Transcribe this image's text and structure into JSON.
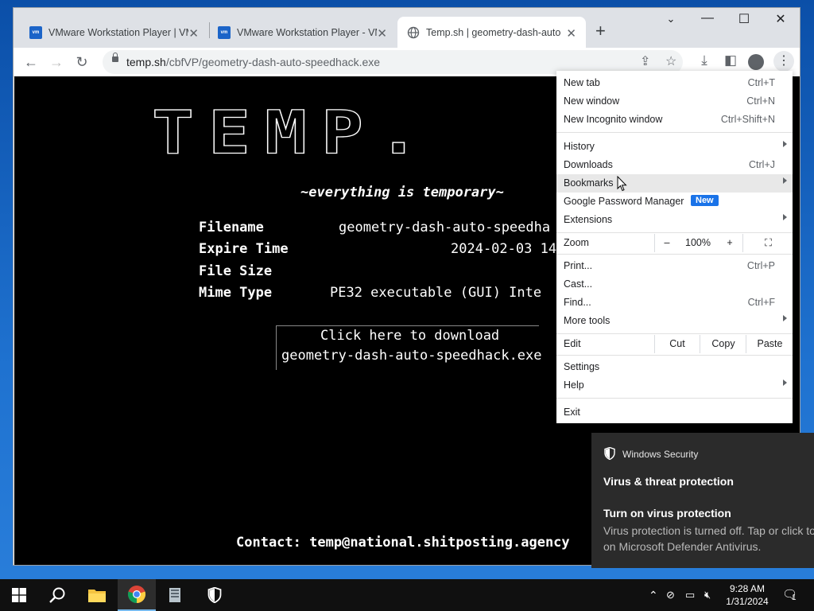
{
  "browser": {
    "tabs": [
      {
        "title": "VMware Workstation Player | VM",
        "favicon": "vmware",
        "active": false
      },
      {
        "title": "VMware Workstation Player - VM",
        "favicon": "vmware",
        "active": false
      },
      {
        "title": "Temp.sh | geometry-dash-auto-s",
        "favicon": "globe",
        "active": true
      }
    ],
    "url_host": "temp.sh",
    "url_path": "/cbfVP/geometry-dash-auto-speedhack.exe"
  },
  "page": {
    "logo": "TEMP.",
    "tagline": "~everything is temporary~",
    "info": [
      {
        "label": "Filename",
        "value": "geometry-dash-auto-speedha"
      },
      {
        "label": "Expire Time",
        "value": "2024-02-03 14"
      },
      {
        "label": "File Size",
        "value": ""
      },
      {
        "label": "Mime Type",
        "value": "PE32 executable (GUI) Inte"
      }
    ],
    "download_line1": "Click here to download",
    "download_line2": "geometry-dash-auto-speedhack.exe",
    "contact_label": "Contact:",
    "contact_email": "temp@national.shitposting.agency"
  },
  "menu": {
    "items": [
      {
        "label": "New tab",
        "shortcut": "Ctrl+T"
      },
      {
        "label": "New window",
        "shortcut": "Ctrl+N"
      },
      {
        "label": "New Incognito window",
        "shortcut": "Ctrl+Shift+N"
      },
      {
        "label": "History",
        "submenu": true
      },
      {
        "label": "Downloads",
        "shortcut": "Ctrl+J"
      },
      {
        "label": "Bookmarks",
        "submenu": true,
        "highlighted": true
      },
      {
        "label": "Google Password Manager",
        "badge": "New"
      },
      {
        "label": "Extensions",
        "submenu": true
      },
      {
        "label": "Print...",
        "shortcut": "Ctrl+P"
      },
      {
        "label": "Cast..."
      },
      {
        "label": "Find...",
        "shortcut": "Ctrl+F"
      },
      {
        "label": "More tools",
        "submenu": true
      },
      {
        "label": "Settings"
      },
      {
        "label": "Help",
        "submenu": true
      },
      {
        "label": "Exit"
      }
    ],
    "zoom_label": "Zoom",
    "zoom_minus": "–",
    "zoom_value": "100%",
    "zoom_plus": "+",
    "edit_label": "Edit",
    "cut": "Cut",
    "copy": "Copy",
    "paste": "Paste"
  },
  "toast": {
    "app": "Windows Security",
    "heading": "Virus & threat protection",
    "title": "Turn on virus protection",
    "body": "Virus protection is turned off. Tap or click to turn on Microsoft Defender Antivirus."
  },
  "taskbar": {
    "time": "9:28 AM",
    "date": "1/31/2024",
    "notifications": "1"
  },
  "colors": {
    "accent": "#1a73e8",
    "page_bg": "#000000",
    "toast_bg": "#2b2b2b",
    "taskbar_bg": "#101010"
  }
}
